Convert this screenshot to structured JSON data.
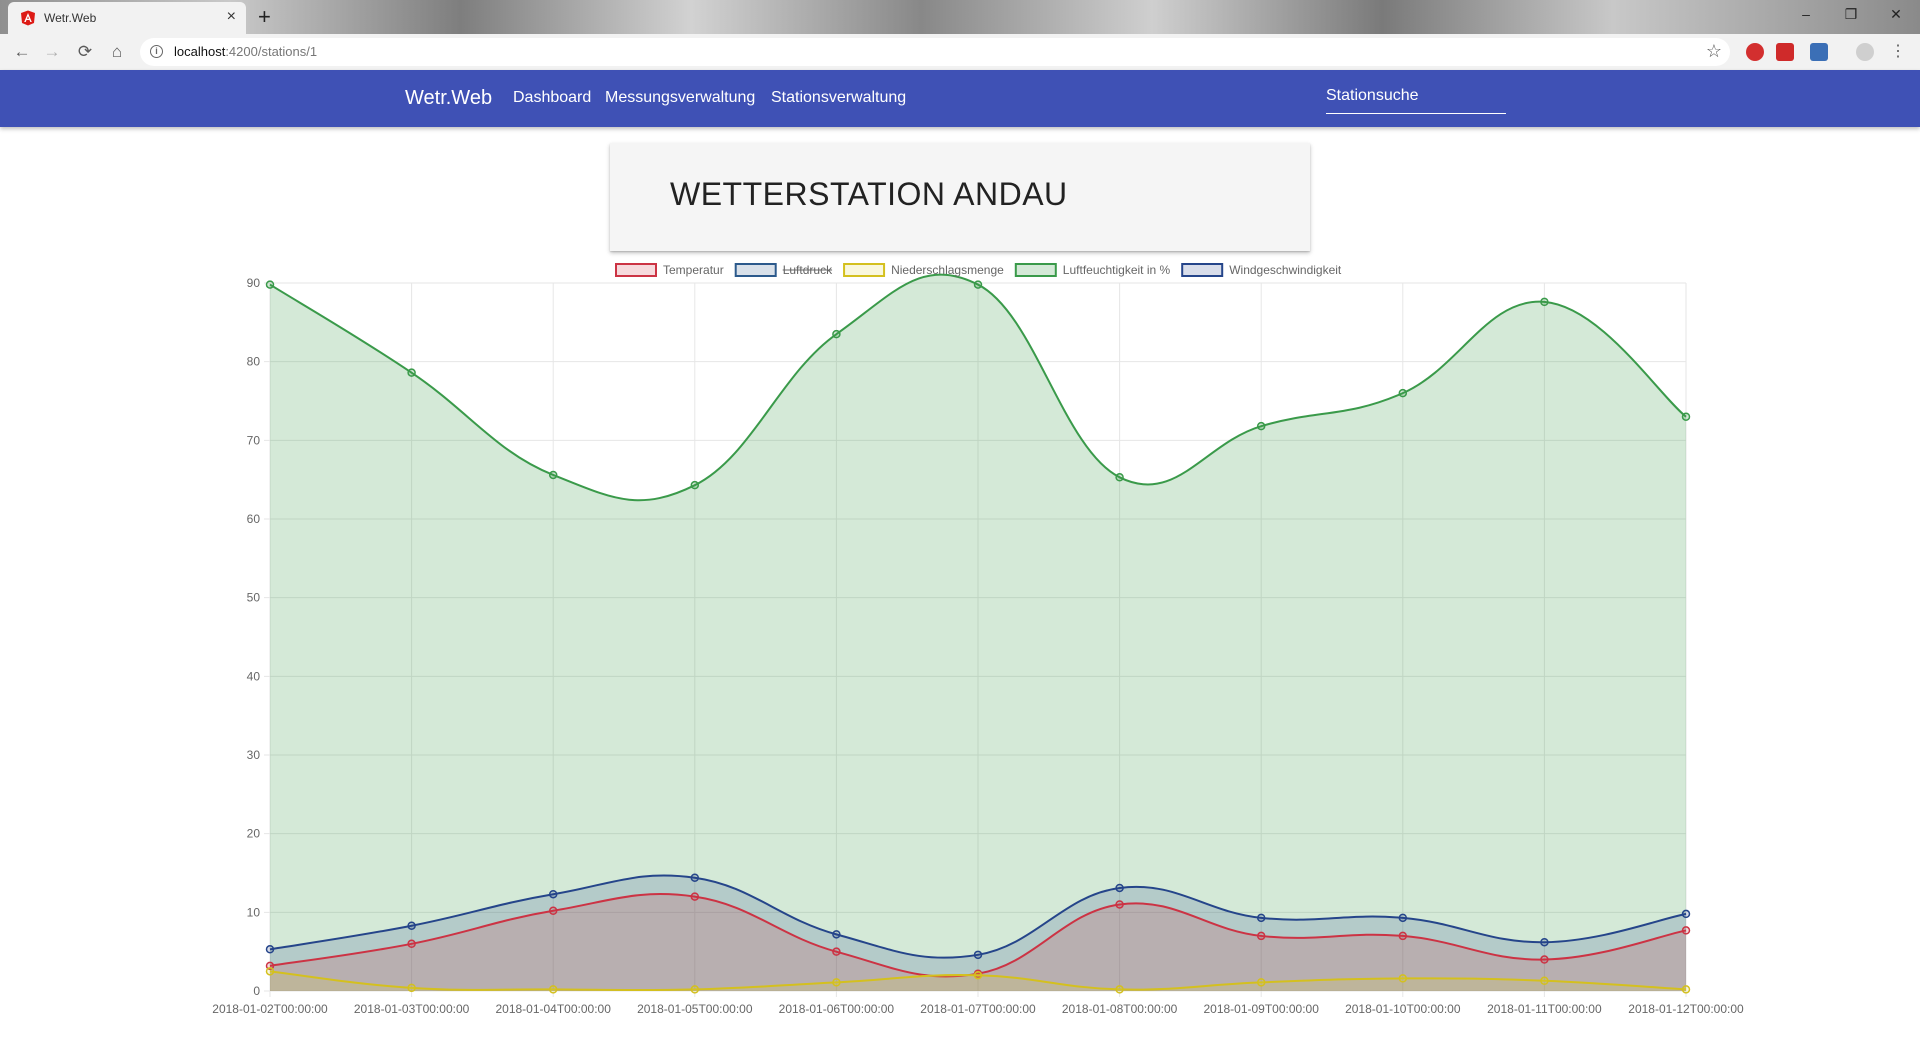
{
  "browser": {
    "tab_title": "Wetr.Web",
    "tab_close": "×",
    "new_tab": "+",
    "url_host": "localhost",
    "url_rest": ":4200/stations/1",
    "controls": {
      "minimize": "–",
      "restore": "❐",
      "close": "✕"
    }
  },
  "nav": {
    "brand": "Wetr.Web",
    "links": [
      "Dashboard",
      "Messungsverwaltung",
      "Stationsverwaltung"
    ],
    "search_placeholder": "Stationsuche"
  },
  "station": {
    "title": "WETTERSTATION ANDAU"
  },
  "chart_data": {
    "type": "area",
    "x": [
      "2018-01-02T00:00:00",
      "2018-01-03T00:00:00",
      "2018-01-04T00:00:00",
      "2018-01-05T00:00:00",
      "2018-01-06T00:00:00",
      "2018-01-07T00:00:00",
      "2018-01-08T00:00:00",
      "2018-01-09T00:00:00",
      "2018-01-10T00:00:00",
      "2018-01-11T00:00:00",
      "2018-01-12T00:00:00"
    ],
    "ylim": [
      0,
      90
    ],
    "yticks": [
      0,
      10,
      20,
      30,
      40,
      50,
      60,
      70,
      80,
      90
    ],
    "grid": true,
    "legend_position": "top",
    "series": [
      {
        "name": "Temperatur",
        "color": "#cc3344",
        "fill": "rgba(204,51,68,0.18)",
        "hidden": false,
        "values": [
          3.2,
          6.0,
          10.2,
          12.0,
          5.0,
          2.2,
          11.0,
          7.0,
          7.0,
          4.0,
          7.7
        ]
      },
      {
        "name": "Luftdruck",
        "color": "#2c5a8c",
        "fill": "rgba(44,90,140,0.18)",
        "hidden": true,
        "values": []
      },
      {
        "name": "Niederschlagsmenge",
        "color": "#d4c01e",
        "fill": "rgba(224,208,60,0.18)",
        "hidden": false,
        "values": [
          2.5,
          0.4,
          0.2,
          0.2,
          1.1,
          2.0,
          0.2,
          1.1,
          1.6,
          1.3,
          0.2
        ]
      },
      {
        "name": "Luftfeuchtigkeit in %",
        "color": "#3a9a4a",
        "fill": "rgba(58,154,74,0.22)",
        "hidden": false,
        "values": [
          89.8,
          78.6,
          65.6,
          64.3,
          83.5,
          89.8,
          65.3,
          71.8,
          76.0,
          87.6,
          73.0
        ]
      },
      {
        "name": "Windgeschwindigkeit",
        "color": "#25458a",
        "fill": "rgba(37,69,138,0.18)",
        "hidden": false,
        "values": [
          5.3,
          8.3,
          12.3,
          14.4,
          7.2,
          4.6,
          13.1,
          9.3,
          9.3,
          6.2,
          9.8
        ]
      }
    ]
  }
}
